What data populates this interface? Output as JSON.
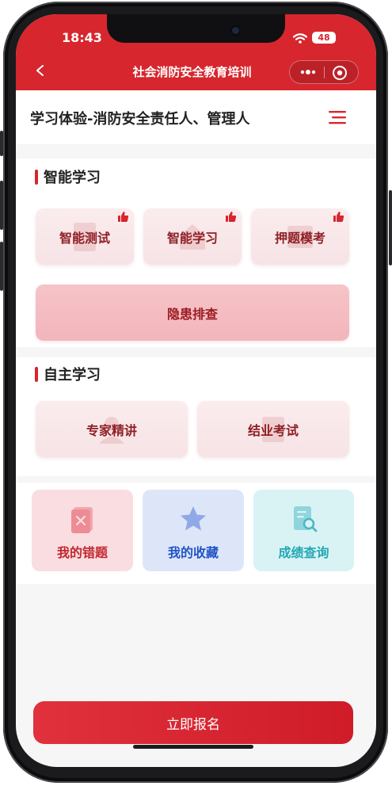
{
  "status_bar": {
    "time": "18:43",
    "battery": "48"
  },
  "nav": {
    "title": "社会消防安全教育培训",
    "back_icon": "chevron-left-icon",
    "more_icon": "more-dots-icon",
    "close_icon": "target-icon"
  },
  "header": {
    "course_title": "学习体验-消防安全责任人、管理人",
    "menu_icon": "menu-icon"
  },
  "smart_section": {
    "title": "智能学习",
    "cards": [
      {
        "label": "智能测试",
        "icon": "thumbs-up-icon"
      },
      {
        "label": "智能学习",
        "icon": "thumbs-up-icon"
      },
      {
        "label": "押题模考",
        "icon": "thumbs-up-icon"
      }
    ],
    "wide_card": {
      "label": "隐患排查"
    }
  },
  "self_section": {
    "title": "自主学习",
    "cards": [
      {
        "label": "专家精讲"
      },
      {
        "label": "结业考试"
      }
    ]
  },
  "quick_tiles": [
    {
      "label": "我的错题",
      "icon": "wrong-questions-icon",
      "bg": "#fadde0",
      "color": "#c2272f"
    },
    {
      "label": "我的收藏",
      "icon": "star-icon",
      "bg": "#dde6f8",
      "color": "#2154c8"
    },
    {
      "label": "成绩查询",
      "icon": "score-search-icon",
      "bg": "#d9f3f5",
      "color": "#23a8b6"
    }
  ],
  "cta": {
    "label": "立即报名"
  },
  "colors": {
    "brand": "#d7262e",
    "accent_dark": "#8f1f25"
  }
}
